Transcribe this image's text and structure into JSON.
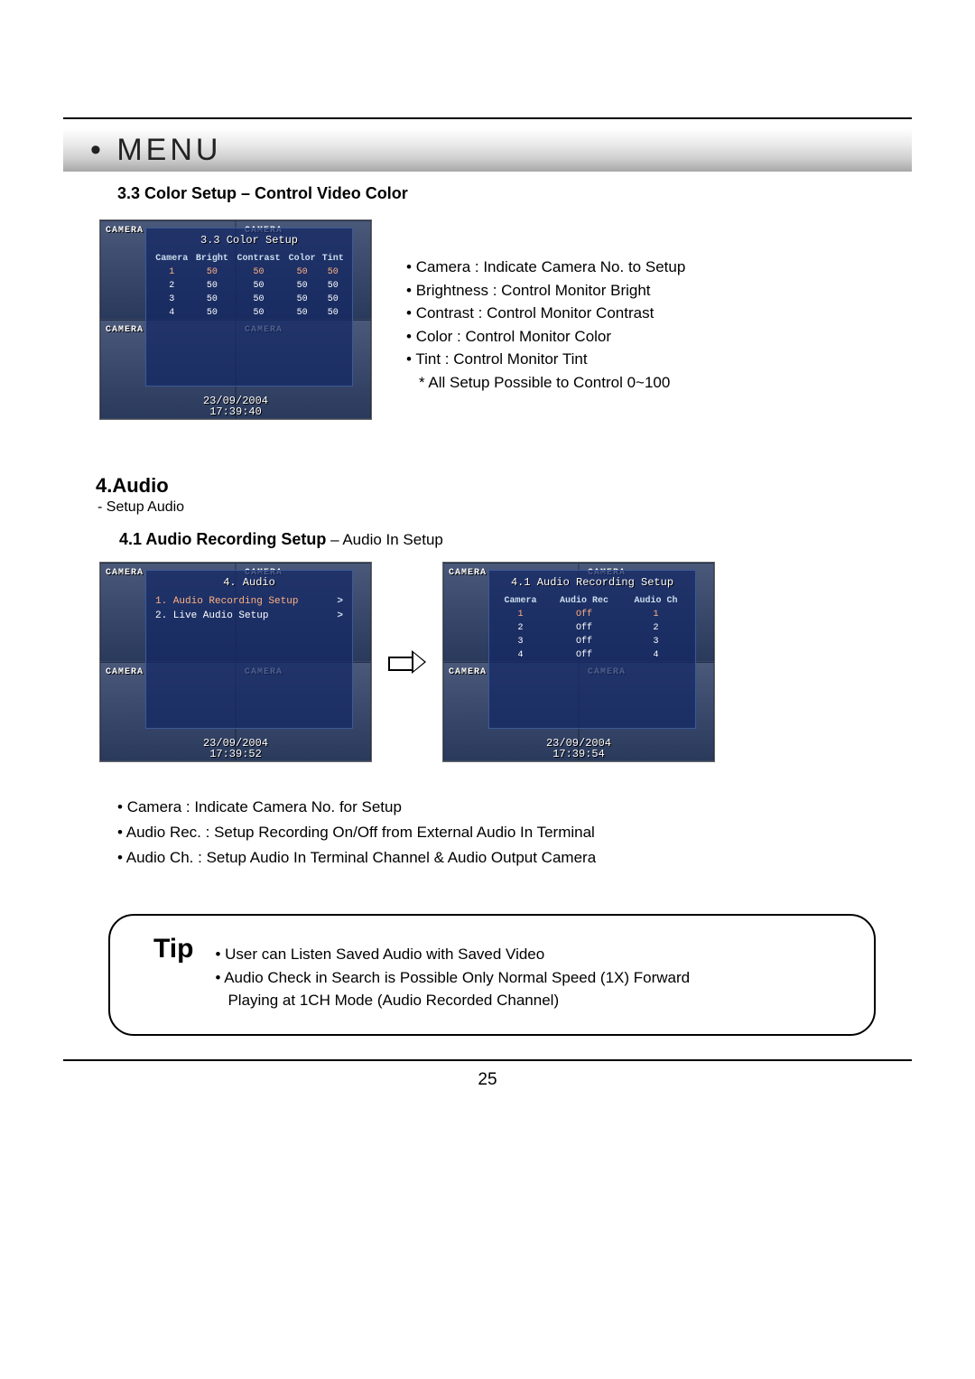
{
  "header": {
    "menu_title": "• MENU"
  },
  "section33": {
    "title": "3.3 Color Setup – Control Video Color",
    "bullets": [
      "Camera : Indicate Camera No. to Setup",
      "Brightness : Control Monitor Bright",
      "Contrast : Control Monitor Contrast",
      "Color : Control Monitor Color",
      "Tint : Control Monitor Tint"
    ],
    "note": "* All Setup Possible to Control 0~100"
  },
  "screenshot1": {
    "title": "3.3 Color Setup",
    "headers": [
      "Camera",
      "Bright",
      "Contrast",
      "Color",
      "Tint"
    ],
    "rows": [
      [
        "1",
        "50",
        "50",
        "50",
        "50"
      ],
      [
        "2",
        "50",
        "50",
        "50",
        "50"
      ],
      [
        "3",
        "50",
        "50",
        "50",
        "50"
      ],
      [
        "4",
        "50",
        "50",
        "50",
        "50"
      ]
    ],
    "timestamp_date": "23/09/2004",
    "timestamp_time": "17:39:40",
    "cam_label": "CAMERA"
  },
  "section4": {
    "title": "4.Audio",
    "subtitle": "- Setup Audio"
  },
  "section41": {
    "title_bold": "4.1 Audio Recording Setup",
    "title_light": " – Audio In Setup"
  },
  "screenshot2": {
    "title": "4. Audio",
    "items": [
      {
        "label": "1. Audio Recording Setup",
        "chev": ">"
      },
      {
        "label": "2. Live Audio Setup",
        "chev": ">"
      }
    ],
    "timestamp_date": "23/09/2004",
    "timestamp_time": "17:39:52",
    "cam_label": "CAMERA"
  },
  "screenshot3": {
    "title": "4.1 Audio Recording Setup",
    "headers": [
      "Camera",
      "Audio Rec",
      "Audio Ch"
    ],
    "rows": [
      [
        "1",
        "Off",
        "1"
      ],
      [
        "2",
        "Off",
        "2"
      ],
      [
        "3",
        "Off",
        "3"
      ],
      [
        "4",
        "Off",
        "4"
      ]
    ],
    "timestamp_date": "23/09/2004",
    "timestamp_time": "17:39:54",
    "cam_label": "CAMERA"
  },
  "section4_bullets": [
    "Camera : Indicate Camera No. for Setup",
    "Audio Rec. : Setup Recording On/Off from External Audio In Terminal",
    "Audio Ch. : Setup Audio In Terminal Channel & Audio Output Camera"
  ],
  "tip": {
    "label": "Tip",
    "bullets": [
      "User can Listen Saved Audio with Saved Video",
      "Audio Check in Search is Possible Only Normal Speed (1X) Forward"
    ],
    "cont": "Playing at 1CH Mode (Audio Recorded Channel)"
  },
  "page_number": "25"
}
